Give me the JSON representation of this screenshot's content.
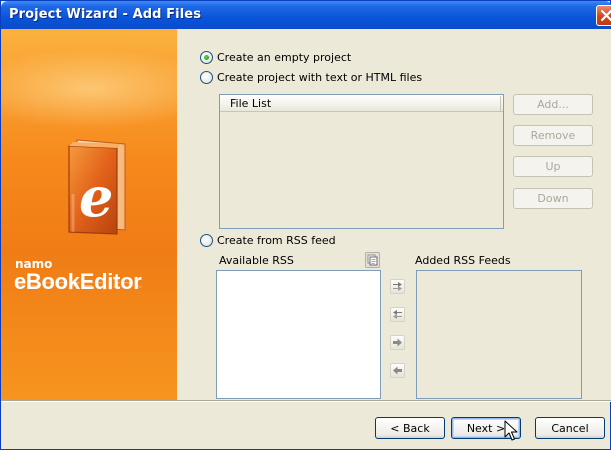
{
  "window": {
    "title": "Project Wizard - Add Files"
  },
  "brand": {
    "small": "namo",
    "large": "eBookEditor"
  },
  "options": {
    "empty_project": {
      "label": "Create an empty project",
      "selected": true
    },
    "text_html_project": {
      "label": "Create project with text or HTML files",
      "selected": false
    },
    "rss_project": {
      "label": "Create from RSS feed",
      "selected": false
    }
  },
  "file_list": {
    "header": "File List",
    "buttons": [
      "Add...",
      "Remove",
      "Up",
      "Down"
    ]
  },
  "rss": {
    "available_label": "Available RSS",
    "added_label": "Added RSS Feeds"
  },
  "footer": {
    "back": "< Back",
    "next": "Next >",
    "cancel": "Cancel"
  },
  "colors": {
    "titlebar": "#0854d9",
    "sidebar": "#f6891c",
    "dialog_bg": "#ece9d8"
  },
  "icons": {
    "close": "close-icon",
    "logo": "ebook-logo-icon",
    "copy": "copy-feed-icon",
    "add_all": "add-all-icon",
    "remove_all": "remove-all-icon",
    "add_one": "add-one-icon",
    "remove_one": "remove-one-icon",
    "cursor": "mouse-pointer-icon"
  }
}
